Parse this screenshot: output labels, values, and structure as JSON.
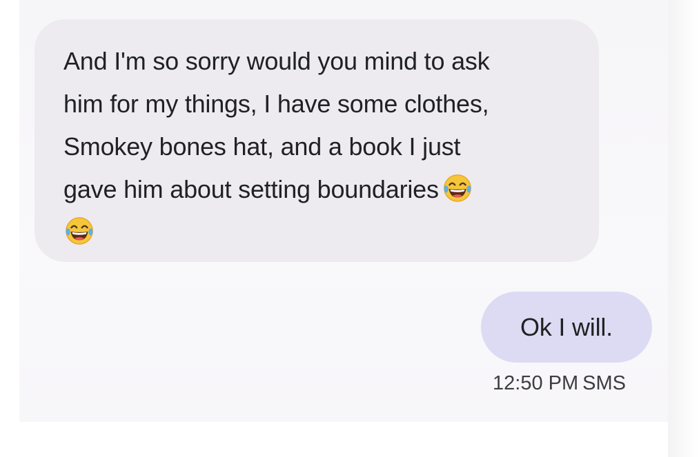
{
  "incoming_message": {
    "lines": [
      "And I'm so sorry would you mind to ask",
      "him for my things, I have some clothes,",
      "Smokey bones hat, and a book I just",
      "gave him about setting boundaries"
    ],
    "emoji": [
      "face-with-tears-of-joy",
      "face-with-tears-of-joy"
    ]
  },
  "outgoing_message": {
    "text": "Ok I will.",
    "time": "12:50 PM",
    "channel": "SMS"
  },
  "colors": {
    "incoming_bubble": "#edebf0",
    "outgoing_bubble": "#dcdbf3",
    "text": "#202124"
  }
}
